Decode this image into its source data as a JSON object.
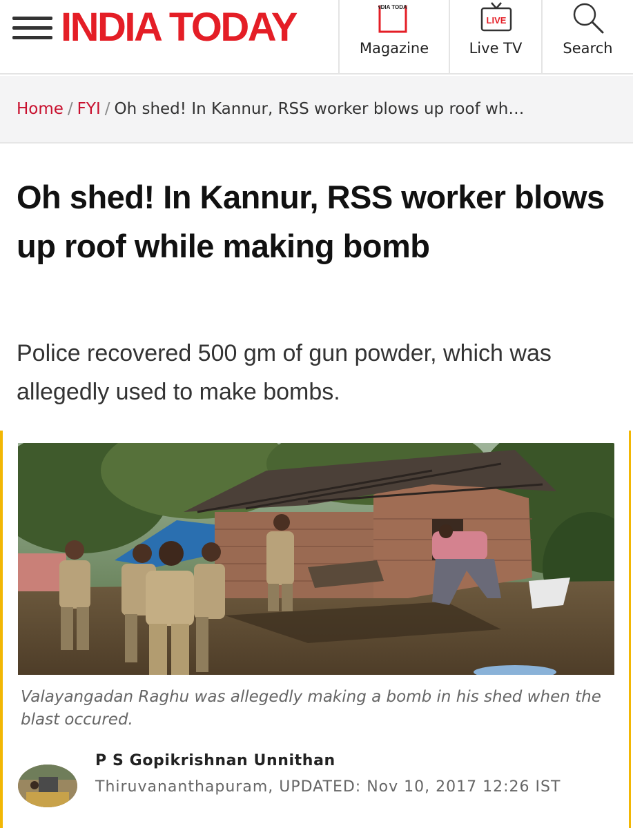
{
  "header": {
    "logo": "INDIA TODAY",
    "magazine_badge": "INDIA TODAY",
    "live_badge": "LIVE",
    "nav": [
      {
        "label": "Magazine",
        "icon": "magazine-icon"
      },
      {
        "label": "Live TV",
        "icon": "live-tv-icon"
      },
      {
        "label": "Search",
        "icon": "search-icon"
      }
    ]
  },
  "breadcrumb": {
    "home": "Home",
    "section": "FYI",
    "current": "Oh shed! In Kannur, RSS worker blows up roof wh…"
  },
  "article": {
    "headline": "Oh shed! In Kannur, RSS worker blows up roof while making bomb",
    "summary": "Police recovered 500 gm of gun powder, which was allegedly used to make bombs.",
    "caption": "Valayangadan Raghu was allegedly making a bomb in his shed when the blast occured.",
    "author": "P S Gopikrishnan Unnithan",
    "dateline": "Thiruvananthapuram, UPDATED: Nov 10, 2017 12:26 IST"
  },
  "colors": {
    "brand_red": "#e41e26",
    "link_red": "#c8102e",
    "accent_yellow": "#f2b705"
  }
}
